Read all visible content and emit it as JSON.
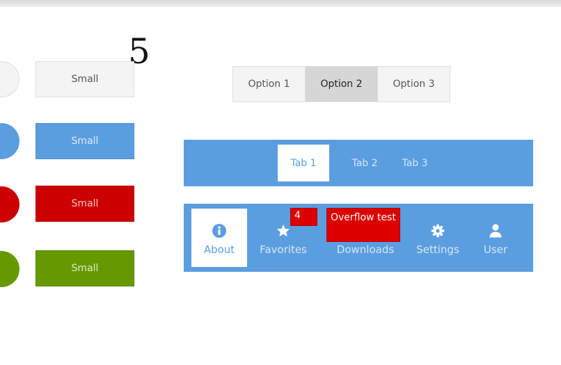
{
  "marker": {
    "number": "5"
  },
  "small_buttons": [
    {
      "label": "Small",
      "variant": "default"
    },
    {
      "label": "Small",
      "variant": "primary"
    },
    {
      "label": "Small",
      "variant": "danger"
    },
    {
      "label": "Small",
      "variant": "success"
    }
  ],
  "segmented": {
    "options": [
      "Option 1",
      "Option 2",
      "Option 3"
    ],
    "selected": "Option 2"
  },
  "tabs": {
    "items": [
      "Tab 1",
      "Tab 2",
      "Tab 3"
    ],
    "active": "Tab 1"
  },
  "icon_tabs": {
    "items": [
      {
        "label": "About",
        "icon": "info-icon"
      },
      {
        "label": "Favorites",
        "icon": "star-icon"
      },
      {
        "label": "Downloads",
        "icon": "download-icon"
      },
      {
        "label": "Settings",
        "icon": "gear-icon"
      },
      {
        "label": "User",
        "icon": "user-icon"
      }
    ],
    "active": "About",
    "favorites_badge": "4",
    "downloads_badge": "Overflow test"
  },
  "colors": {
    "accent": "#5b9ee0",
    "danger": "#cc0000",
    "success": "#669900",
    "default": "#f4f4f4"
  }
}
